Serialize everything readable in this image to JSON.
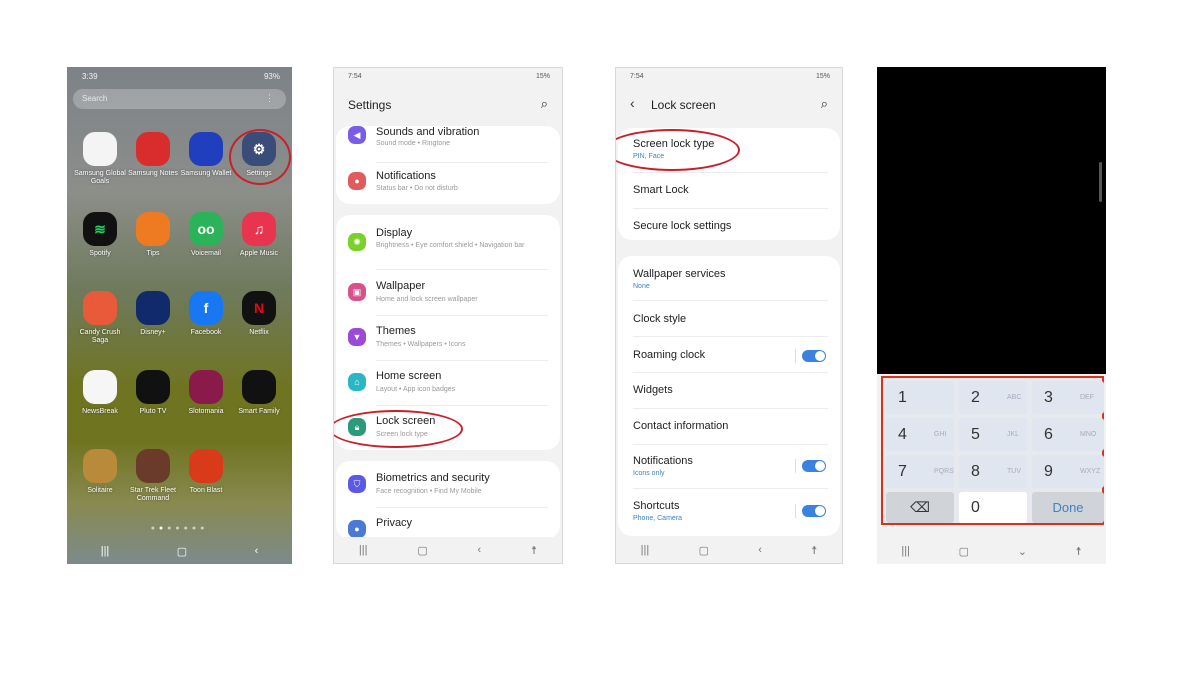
{
  "home": {
    "status_time": "3:39",
    "status_right": "93%",
    "search_placeholder": "Search",
    "apps": [
      {
        "label": "Samsung Global Goals",
        "icon": "globe-icon",
        "color": "#f4f4f4"
      },
      {
        "label": "Samsung Notes",
        "icon": "notes-icon",
        "color": "#d92d2d"
      },
      {
        "label": "Samsung Wallet",
        "icon": "wallet-icon",
        "color": "#1f3fbf"
      },
      {
        "label": "Settings",
        "icon": "gear-icon",
        "color": "#3a4d7a"
      },
      {
        "label": "Spotify",
        "icon": "spotify-icon",
        "color": "#111111"
      },
      {
        "label": "Tips",
        "icon": "bulb-icon",
        "color": "#ee7a22"
      },
      {
        "label": "Voicemail",
        "icon": "voicemail-icon",
        "color": "#2cb35a"
      },
      {
        "label": "Apple Music",
        "icon": "music-icon",
        "color": "#e8344f"
      },
      {
        "label": "Candy Crush Saga",
        "icon": "candy-icon",
        "color": "#e85a3a"
      },
      {
        "label": "Disney+",
        "icon": "disney-icon",
        "color": "#102a6b"
      },
      {
        "label": "Facebook",
        "icon": "facebook-icon",
        "color": "#1877f2"
      },
      {
        "label": "Netflix",
        "icon": "netflix-icon",
        "color": "#111111"
      },
      {
        "label": "NewsBreak",
        "icon": "newsbreak-icon",
        "color": "#f6f6f6"
      },
      {
        "label": "Pluto TV",
        "icon": "pluto-icon",
        "color": "#111111"
      },
      {
        "label": "Slotomania",
        "icon": "slots-icon",
        "color": "#8a1a4a"
      },
      {
        "label": "Smart Family",
        "icon": "family-icon",
        "color": "#111111"
      },
      {
        "label": "Solitaire",
        "icon": "solitaire-icon",
        "color": "#b88a3a"
      },
      {
        "label": "Star Trek Fleet Command",
        "icon": "startrek-icon",
        "color": "#6a3a2a"
      },
      {
        "label": "Toon Blast",
        "icon": "toonblast-icon",
        "color": "#d83a1a"
      }
    ]
  },
  "settings": {
    "status_time": "7:54",
    "status_right": "15%",
    "title": "Settings",
    "items": [
      {
        "title": "Sounds and vibration",
        "sub": "Sound mode  •  Ringtone",
        "color": "#7a5ce6",
        "icon": "speaker-icon"
      },
      {
        "title": "Notifications",
        "sub": "Status bar  •  Do not disturb",
        "color": "#e35a5a",
        "icon": "notification-icon"
      },
      {
        "title": "Display",
        "sub": "Brightness  •  Eye comfort shield  •  Navigation bar",
        "color": "#7ad12a",
        "icon": "sun-icon"
      },
      {
        "title": "Wallpaper",
        "sub": "Home and lock screen wallpaper",
        "color": "#d9508a",
        "icon": "image-icon"
      },
      {
        "title": "Themes",
        "sub": "Themes  •  Wallpapers  •  Icons",
        "color": "#9a4ad6",
        "icon": "brush-icon"
      },
      {
        "title": "Home screen",
        "sub": "Layout  •  App icon badges",
        "color": "#2bb6c6",
        "icon": "home-icon"
      },
      {
        "title": "Lock screen",
        "sub": "Screen lock type",
        "color": "#2a9a7a",
        "icon": "lock-icon"
      },
      {
        "title": "Biometrics and security",
        "sub": "Face recognition  •  Find My Mobile",
        "color": "#5a5ae6",
        "icon": "shield-icon"
      },
      {
        "title": "Privacy",
        "sub": "",
        "color": "#4a7ad6",
        "icon": "privacy-icon"
      }
    ]
  },
  "lock": {
    "status_time": "7:54",
    "status_right": "15%",
    "title": "Lock screen",
    "items": [
      {
        "title": "Screen lock type",
        "sub": "PIN, Face"
      },
      {
        "title": "Smart Lock",
        "sub": ""
      },
      {
        "title": "Secure lock settings",
        "sub": ""
      },
      {
        "title": "Wallpaper services",
        "sub": "None"
      },
      {
        "title": "Clock style",
        "sub": ""
      },
      {
        "title": "Roaming clock",
        "sub": "",
        "toggle": true
      },
      {
        "title": "Widgets",
        "sub": ""
      },
      {
        "title": "Contact information",
        "sub": ""
      },
      {
        "title": "Notifications",
        "sub": "Icons only",
        "toggle": true
      },
      {
        "title": "Shortcuts",
        "sub": "Phone, Camera",
        "toggle": true
      }
    ]
  },
  "keypad": {
    "keys": [
      {
        "n": "1",
        "l": ""
      },
      {
        "n": "2",
        "l": "ABC"
      },
      {
        "n": "3",
        "l": "DEF"
      },
      {
        "n": "4",
        "l": "GHI"
      },
      {
        "n": "5",
        "l": "JKL"
      },
      {
        "n": "6",
        "l": "MNO"
      },
      {
        "n": "7",
        "l": "PQRS"
      },
      {
        "n": "8",
        "l": "TUV"
      },
      {
        "n": "9",
        "l": "WXYZ"
      }
    ],
    "zero": "0",
    "done": "Done"
  },
  "nav": {
    "recents": "|||",
    "home": "▢",
    "back": "‹",
    "down": "⌄",
    "access": "☨"
  }
}
